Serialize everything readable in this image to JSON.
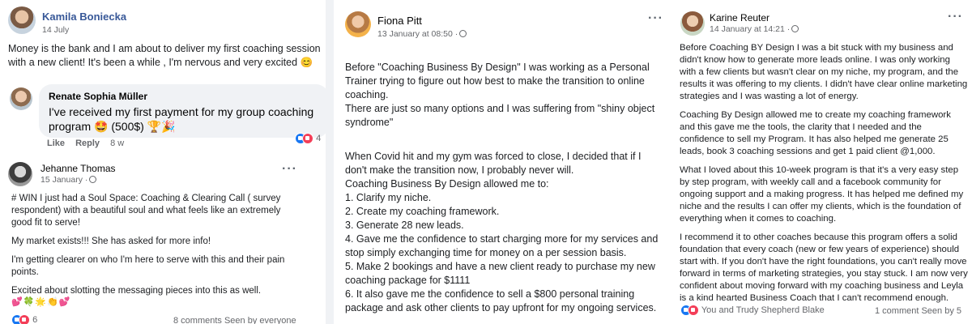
{
  "posts": {
    "kamila": {
      "name": "Kamila Boniecka",
      "date": "14 July",
      "text": "Money is the bank and I am about to deliver my first coaching session with a new client! It's been a while , I'm nervous and very excited 😊",
      "comment": {
        "author": "Renate Sophia Müller",
        "text": "I've received my first payment for my group coaching program 🤩 (500$) 🏆🎉",
        "like_label": "Like",
        "reply_label": "Reply",
        "time": "8 w",
        "reaction_count": "4"
      }
    },
    "jehanne": {
      "name": "Jehanne Thomas",
      "date": "15 January ·",
      "paragraphs": [
        "# WIN I just had a Soul Space: Coaching & Clearing Call ( survey respondent) with a beautiful soul and  what feels like an extremely good fit to serve!",
        "My market exists!!! She has asked for more info!",
        "I'm getting clearer on who I'm here to serve with this and their pain points.",
        "Excited about slotting the messaging pieces into this as well."
      ],
      "emojis": "💕🍀🌟👏💕",
      "reaction_count": "6",
      "footer": "8 comments  Seen by everyone"
    },
    "fiona": {
      "name": "Fiona Pitt",
      "date": "13 January at 08:50 ·",
      "paragraphs": [
        "Before \"Coaching Business By Design\" I was working as a Personal Trainer trying to figure out how best to make the transition to online coaching.\nThere are just so many options and I was suffering from \"shiny object syndrome\"",
        "When Covid hit and my gym was forced to close, I decided that if I don't make the transition now, I probably never will.\nCoaching Business By Design allowed me to:\n1. Clarify my niche.\n2. Create my coaching framework.\n3. Generate 28 new leads.\n4. Gave me the confidence to start charging more for my services and stop simply exchanging time for money on a per session basis.\n5. Make 2 bookings and have a new client ready to purchase my new coaching package for $1111\n6. It also gave me the confidence to sell a $800 personal training package and ask other clients to pay upfront for my ongoing services."
      ]
    },
    "karine": {
      "name": "Karine Reuter",
      "date": "14 January at 14:21 ·",
      "paragraphs": [
        "Before Coaching BY Design I was a bit stuck with my business and didn't know how to generate more leads online. I was only working with a few clients but wasn't clear on my niche, my program, and the results it was offering to my clients. I didn't have clear online marketing strategies and I was wasting a lot of energy.",
        "Coaching By Design allowed me to create my coaching framework and this gave me the tools, the clarity that I needed and the confidence to sell my Program. It has also helped me generate 25 leads, book 3 coaching sessions and get 1 paid client @1,000.",
        "What I loved about this 10-week program is that it's a very easy step by step program, with weekly call and a facebook community for ongoing support and a making progress. It has helped me defined my niche and the results I can offer my clients, which is the foundation of everything when it comes to coaching.",
        "I recommend it to other coaches because this program offers a solid foundation that every coach (new or few years of experience) should start with. If you don't have the right foundations, you can't really move forward in terms of marketing strategies, you stay stuck. I am now very confident about moving forward with my coaching business and Leyla is a kind hearted Business Coach that I can't recommend enough."
      ],
      "reactions_text": "You and Trudy Shepherd Blake",
      "footer": "1 comment  Seen by 5"
    }
  },
  "colors": {
    "name_link": "#385898",
    "meta": "#65676b",
    "like": "#1877f2",
    "love": "#f33e58"
  }
}
